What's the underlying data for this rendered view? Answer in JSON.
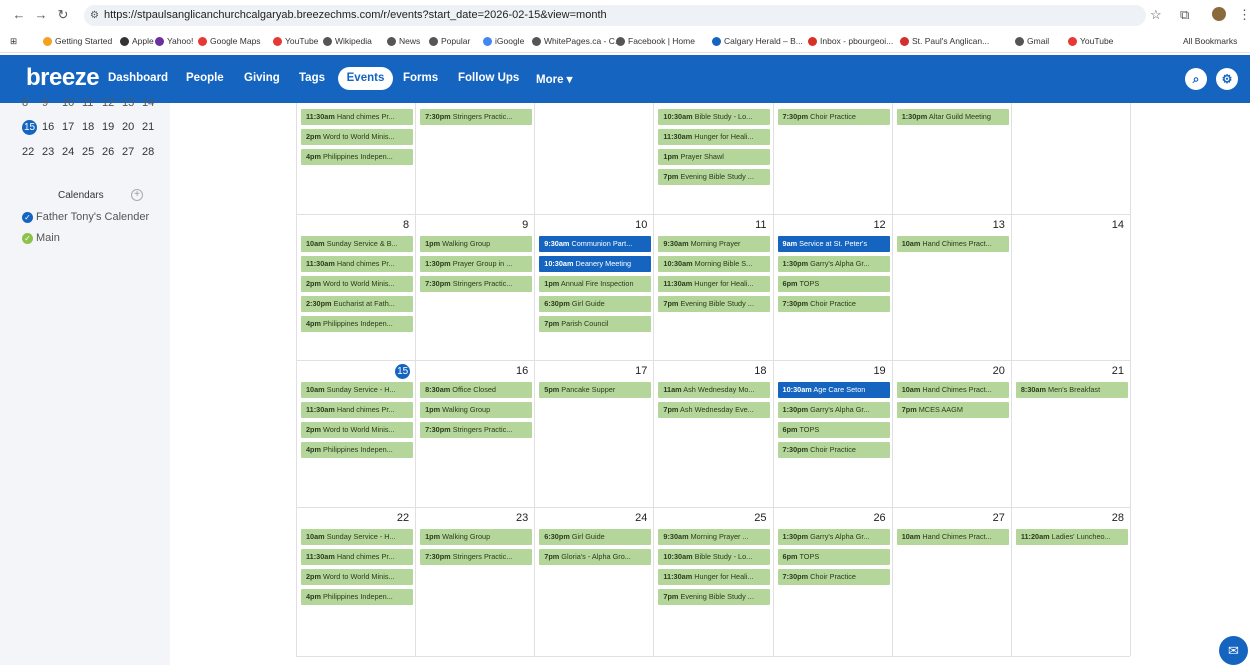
{
  "browser": {
    "url": "https://stpaulsanglicanchurchcalgaryab.breezechms.com/r/events?start_date=2026-02-15&view=month",
    "bookmarks": [
      "Getting Started",
      "Apple",
      "Yahoo!",
      "Google Maps",
      "YouTube",
      "Wikipedia",
      "News",
      "Popular",
      "iGoogle",
      "WhitePages.ca - C...",
      "Facebook | Home",
      "Calgary Herald – B...",
      "Inbox - pbourgeoi...",
      "St. Paul's Anglican...",
      "Gmail",
      "YouTube"
    ],
    "all_bookmarks": "All Bookmarks"
  },
  "header": {
    "logo": "breeze",
    "nav": [
      "Dashboard",
      "People",
      "Giving",
      "Tags",
      "Events",
      "Forms",
      "Follow Ups",
      "More ▾"
    ],
    "active": "Events"
  },
  "sidebar": {
    "mini_rows": [
      [
        "15",
        "16",
        "17",
        "18",
        "19",
        "20",
        "21"
      ],
      [
        "22",
        "23",
        "24",
        "25",
        "26",
        "27",
        "28"
      ]
    ],
    "calendars_heading": "Calendars",
    "calendars": [
      {
        "name": "Father Tony's Calender",
        "color": "#1565c0"
      },
      {
        "name": "Main",
        "color": "#8bc34a"
      }
    ]
  },
  "weeks": [
    {
      "days": [
        "",
        "",
        "",
        "",
        "",
        "",
        ""
      ],
      "events": [
        [
          {
            "time": "11:30am",
            "title": "Hand chimes Pr..."
          },
          {
            "time": "2pm",
            "title": "Word to World Minis..."
          },
          {
            "time": "4pm",
            "title": "Philippines Indepen..."
          }
        ],
        [
          {
            "time": "7:30pm",
            "title": "Stringers Practic..."
          }
        ],
        [],
        [
          {
            "time": "10:30am",
            "title": "Bible Study - Lo..."
          },
          {
            "time": "11:30am",
            "title": "Hunger for Heali..."
          },
          {
            "time": "1pm",
            "title": "Prayer Shawl"
          },
          {
            "time": "7pm",
            "title": "Evening Bible Study ..."
          }
        ],
        [
          {
            "time": "7:30pm",
            "title": "Choir Practice"
          }
        ],
        [
          {
            "time": "1:30pm",
            "title": "Altar Guild Meeting"
          }
        ],
        []
      ]
    },
    {
      "days": [
        "8",
        "9",
        "10",
        "11",
        "12",
        "13",
        "14"
      ],
      "events": [
        [
          {
            "time": "10am",
            "title": "Sunday Service & B..."
          },
          {
            "time": "11:30am",
            "title": "Hand chimes Pr..."
          },
          {
            "time": "2pm",
            "title": "Word to World Minis..."
          },
          {
            "time": "2:30pm",
            "title": "Eucharist at Fath..."
          },
          {
            "time": "4pm",
            "title": "Philippines Indepen..."
          }
        ],
        [
          {
            "time": "1pm",
            "title": "Walking Group"
          },
          {
            "time": "1:30pm",
            "title": "Prayer Group in ..."
          },
          {
            "time": "7:30pm",
            "title": "Stringers Practic..."
          }
        ],
        [
          {
            "time": "9:30am",
            "title": "Communion Part...",
            "blue": true
          },
          {
            "time": "10:30am",
            "title": "Deanery Meeting",
            "blue": true
          },
          {
            "time": "1pm",
            "title": "Annual Fire Inspection"
          },
          {
            "time": "6:30pm",
            "title": "Girl Guide"
          },
          {
            "time": "7pm",
            "title": "Parish Council"
          }
        ],
        [
          {
            "time": "9:30am",
            "title": "Morning Prayer"
          },
          {
            "time": "10:30am",
            "title": "Morning Bible S..."
          },
          {
            "time": "11:30am",
            "title": "Hunger for Heali..."
          },
          {
            "time": "7pm",
            "title": "Evening Bible Study ..."
          }
        ],
        [
          {
            "time": "9am",
            "title": "Service at St. Peter's",
            "blue": true
          },
          {
            "time": "1:30pm",
            "title": "Garry's Alpha Gr..."
          },
          {
            "time": "6pm",
            "title": "TOPS"
          },
          {
            "time": "7:30pm",
            "title": "Choir Practice"
          }
        ],
        [
          {
            "time": "10am",
            "title": "Hand Chimes Pract..."
          }
        ],
        []
      ]
    },
    {
      "days": [
        "15",
        "16",
        "17",
        "18",
        "19",
        "20",
        "21"
      ],
      "today_index": 0,
      "events": [
        [
          {
            "time": "10am",
            "title": "Sunday Service - H..."
          },
          {
            "time": "11:30am",
            "title": "Hand chimes Pr..."
          },
          {
            "time": "2pm",
            "title": "Word to World Minis..."
          },
          {
            "time": "4pm",
            "title": "Philippines Indepen..."
          }
        ],
        [
          {
            "time": "8:30am",
            "title": "Office Closed"
          },
          {
            "time": "1pm",
            "title": "Walking Group"
          },
          {
            "time": "7:30pm",
            "title": "Stringers Practic..."
          }
        ],
        [
          {
            "time": "5pm",
            "title": "Pancake Supper"
          }
        ],
        [
          {
            "time": "11am",
            "title": "Ash Wednesday Mo..."
          },
          {
            "time": "7pm",
            "title": "Ash Wednesday Eve..."
          }
        ],
        [
          {
            "time": "10:30am",
            "title": "Age Care Seton",
            "blue": true
          },
          {
            "time": "1:30pm",
            "title": "Garry's Alpha Gr..."
          },
          {
            "time": "6pm",
            "title": "TOPS"
          },
          {
            "time": "7:30pm",
            "title": "Choir Practice"
          }
        ],
        [
          {
            "time": "10am",
            "title": "Hand Chimes Pract..."
          },
          {
            "time": "7pm",
            "title": "MCES AAGM"
          }
        ],
        [
          {
            "time": "8:30am",
            "title": "Men's Breakfast"
          }
        ]
      ]
    },
    {
      "days": [
        "22",
        "23",
        "24",
        "25",
        "26",
        "27",
        "28"
      ],
      "events": [
        [
          {
            "time": "10am",
            "title": "Sunday Service - H..."
          },
          {
            "time": "11:30am",
            "title": "Hand chimes Pr..."
          },
          {
            "time": "2pm",
            "title": "Word to World Minis..."
          },
          {
            "time": "4pm",
            "title": "Philippines Indepen..."
          }
        ],
        [
          {
            "time": "1pm",
            "title": "Walking Group"
          },
          {
            "time": "7:30pm",
            "title": "Stringers Practic..."
          }
        ],
        [
          {
            "time": "6:30pm",
            "title": "Girl Guide"
          },
          {
            "time": "7pm",
            "title": "Gloria's - Alpha Gro..."
          }
        ],
        [
          {
            "time": "9:30am",
            "title": "Morning Prayer ..."
          },
          {
            "time": "10:30am",
            "title": "Bible Study - Lo..."
          },
          {
            "time": "11:30am",
            "title": "Hunger for Heali..."
          },
          {
            "time": "7pm",
            "title": "Evening Bible Study ..."
          }
        ],
        [
          {
            "time": "1:30pm",
            "title": "Garry's Alpha Gr..."
          },
          {
            "time": "6pm",
            "title": "TOPS"
          },
          {
            "time": "7:30pm",
            "title": "Choir Practice"
          }
        ],
        [
          {
            "time": "10am",
            "title": "Hand Chimes Pract..."
          }
        ],
        [
          {
            "time": "11:20am",
            "title": "Ladies' Luncheo..."
          }
        ]
      ]
    }
  ]
}
